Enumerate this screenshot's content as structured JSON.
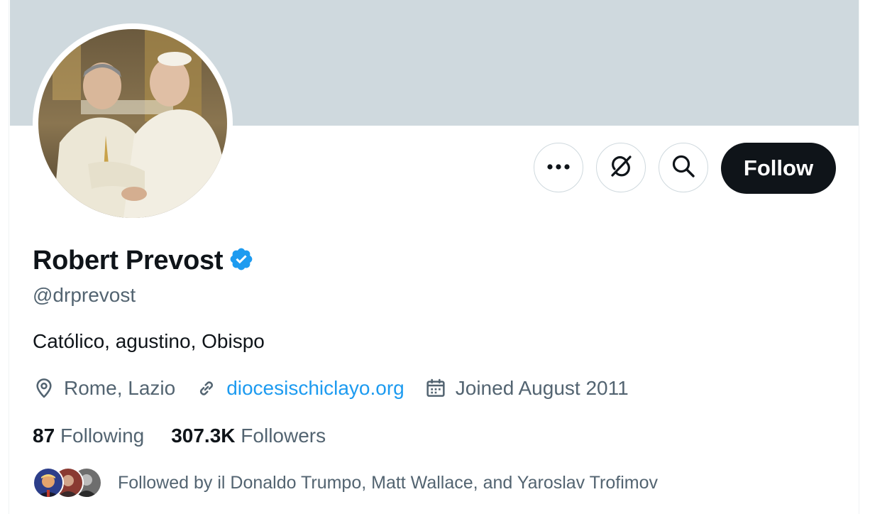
{
  "profile": {
    "name": "Robert Prevost",
    "handle": "@drprevost",
    "bio": "Católico, agustino, Obispo",
    "location": "Rome, Lazio",
    "website": "diocesischiclayo.org",
    "joined": "Joined August 2011",
    "verified": true
  },
  "actions": {
    "more_icon": "ellipsis-icon",
    "grok_icon": "grok-icon",
    "search_icon": "search-icon",
    "follow_label": "Follow"
  },
  "stats": {
    "following_count": "87",
    "following_label": "Following",
    "followers_count": "307.3K",
    "followers_label": "Followers"
  },
  "followed_by": {
    "text": "Followed by il Donaldo Trumpo, Matt Wallace, and Yaroslav Trofimov"
  },
  "colors": {
    "banner": "#cfd9de",
    "verified_badge": "#1d9bf0",
    "link": "#1d9bf0",
    "follow_button": "#0f1419",
    "secondary_text": "#536471"
  }
}
